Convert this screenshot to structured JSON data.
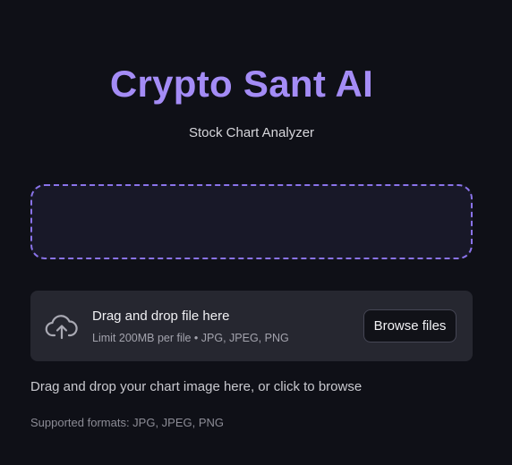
{
  "header": {
    "title": "Crypto Sant AI",
    "subtitle": "Stock Chart Analyzer"
  },
  "uploader": {
    "icon": "cloud-upload-icon",
    "title": "Drag and drop file here",
    "limit": "Limit 200MB per file • JPG, JPEG, PNG",
    "browse_label": "Browse files"
  },
  "instructions": "Drag and drop your chart image here, or click to browse",
  "formats_note": "Supported formats: JPG, JPEG, PNG",
  "colors": {
    "background": "#0f1017",
    "accent": "#a48cf6",
    "dashed_border": "#8a73ea",
    "panel": "#262730"
  }
}
